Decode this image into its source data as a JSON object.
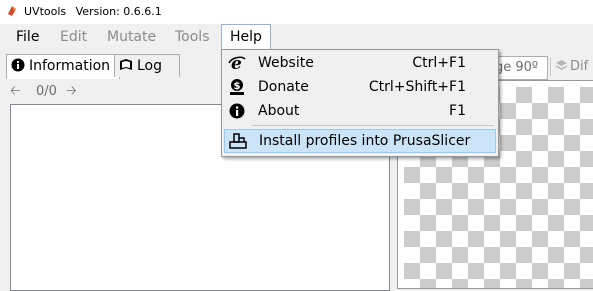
{
  "window": {
    "app_name": "UVtools",
    "version": "Version: 0.6.6.1"
  },
  "menubar": {
    "items": [
      {
        "label": "File",
        "enabled": true
      },
      {
        "label": "Edit",
        "enabled": false
      },
      {
        "label": "Mutate",
        "enabled": false
      },
      {
        "label": "Tools",
        "enabled": false
      },
      {
        "label": "Help",
        "enabled": true,
        "open": true
      }
    ]
  },
  "help_menu": {
    "items": [
      {
        "label": "Website",
        "shortcut": "Ctrl+F1",
        "icon": "internet-explorer-icon"
      },
      {
        "label": "Donate",
        "shortcut": "Ctrl+Shift+F1",
        "icon": "donate-icon"
      },
      {
        "label": "About",
        "shortcut": "F1",
        "icon": "info-icon"
      },
      {
        "label": "Install profiles into PrusaSlicer",
        "shortcut": "",
        "icon": "install-profiles-icon",
        "highlighted": true
      }
    ]
  },
  "tabs": [
    {
      "label": "Information",
      "icon": "info-icon",
      "active": true
    },
    {
      "label": "Log",
      "icon": "book-icon",
      "active": false
    }
  ],
  "navigation": {
    "counter": "0/0"
  },
  "toolbar": {
    "rotate_label": "ge 90º",
    "diff_label": "Dif"
  },
  "colors": {
    "menu_highlight": "#cce4f7",
    "menu_highlight_border": "#99c9ef",
    "checker_dark": "#cccccc"
  }
}
